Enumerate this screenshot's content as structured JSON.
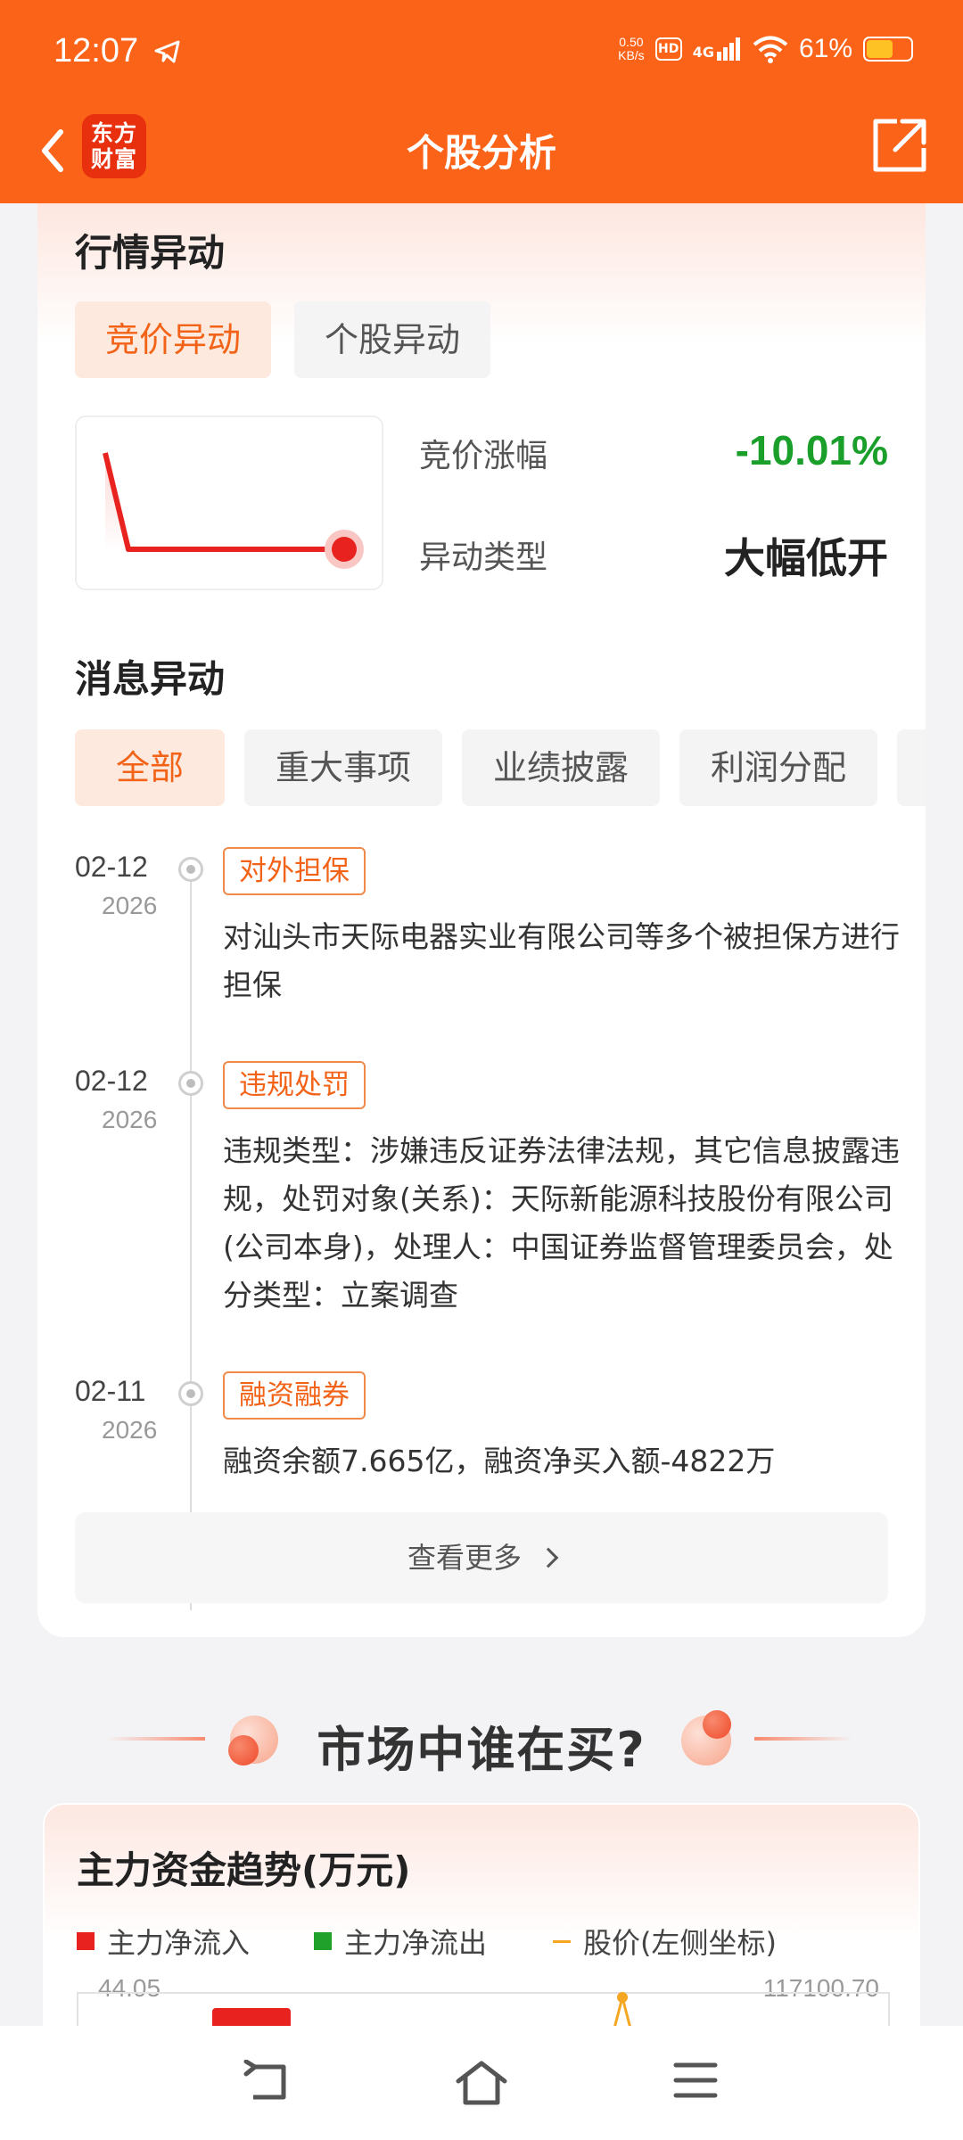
{
  "status": {
    "time": "12:07",
    "speed_value": "0.50",
    "speed_unit": "KB/s",
    "hd": "HD",
    "net": "4G",
    "battery_pct": "61%",
    "battery_level": 0.61
  },
  "header": {
    "logo_line1": "东方",
    "logo_line2": "财富",
    "title": "个股分析"
  },
  "market_anomaly": {
    "title": "行情异动",
    "tabs": [
      "竞价异动",
      "个股异动"
    ],
    "active_tab": 0,
    "auction_change_label": "竞价涨幅",
    "auction_change_value": "-10.01%",
    "anomaly_type_label": "异动类型",
    "anomaly_type_value": "大幅低开"
  },
  "news_anomaly": {
    "title": "消息异动",
    "filters": [
      "全部",
      "重大事项",
      "业绩披露",
      "利润分配"
    ],
    "active_filter": 0,
    "items": [
      {
        "date": "02-12",
        "year": "2026",
        "tag": "对外担保",
        "text": "对汕头市天际电器实业有限公司等多个被担保方进行担保"
      },
      {
        "date": "02-12",
        "year": "2026",
        "tag": "违规处罚",
        "text": "违规类型：涉嫌违反证券法律法规，其它信息披露违规，处罚对象(关系)：天际新能源科技股份有限公司(公司本身)，处理人：中国证券监督管理委员会，处分类型：立案调查"
      },
      {
        "date": "02-11",
        "year": "2026",
        "tag": "融资融券",
        "text": "融资余额7.665亿，融资净买入额-4822万"
      }
    ],
    "more_label": "查看更多"
  },
  "banner": {
    "text": "市场中谁在买?"
  },
  "fund_trend": {
    "title": "主力资金趋势(万元)",
    "legend": [
      {
        "label": "主力净流入",
        "color": "#e8231f"
      },
      {
        "label": "主力净流出",
        "color": "#1fa12b"
      },
      {
        "label": "股价(左侧坐标)",
        "color": "#f5a623"
      }
    ],
    "left_axis_top": "44.05",
    "right_axis_top": "117100.70"
  },
  "colors": {
    "brand_orange": "#fb6318",
    "down_green": "#1b9f2b",
    "accent_red": "#e8231f"
  }
}
